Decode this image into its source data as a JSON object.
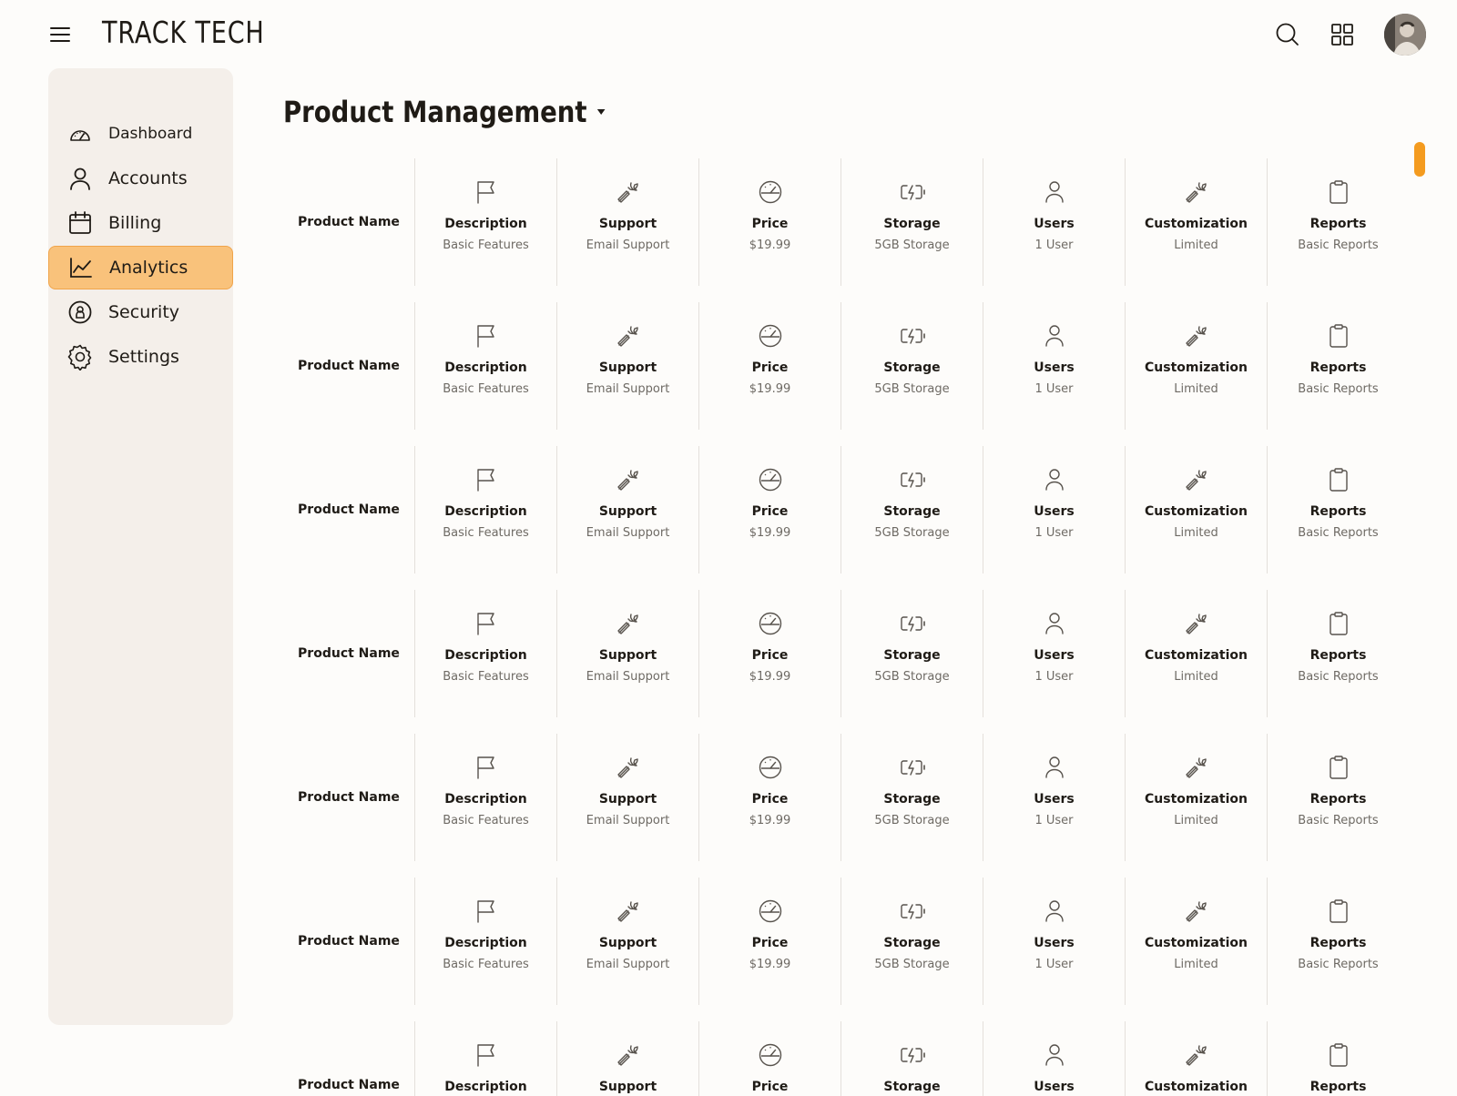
{
  "header": {
    "brand": "TRACK TECH"
  },
  "sidebar": {
    "items": [
      {
        "label": "Dashboard",
        "icon": "gauge-icon"
      },
      {
        "label": "Accounts",
        "icon": "user-icon"
      },
      {
        "label": "Billing",
        "icon": "calendar-icon"
      },
      {
        "label": "Analytics",
        "icon": "chart-line-icon",
        "active": true
      },
      {
        "label": "Security",
        "icon": "shield-lock-icon"
      },
      {
        "label": "Settings",
        "icon": "gear-icon"
      }
    ]
  },
  "main": {
    "title": "Product Management",
    "row_label": "Product Name",
    "columns": [
      {
        "title": "Description",
        "value": "Basic Features",
        "icon": "flag-icon"
      },
      {
        "title": "Support",
        "value": "Email Support",
        "icon": "wrench-icon"
      },
      {
        "title": "Price",
        "value": "$19.99",
        "icon": "gauge-icon"
      },
      {
        "title": "Storage",
        "value": "5GB Storage",
        "icon": "battery-bolt-icon"
      },
      {
        "title": "Users",
        "value": "1 User",
        "icon": "user-icon"
      },
      {
        "title": "Customization",
        "value": "Limited",
        "icon": "wrench-icon"
      },
      {
        "title": "Reports",
        "value": "Basic Reports",
        "icon": "clipboard-icon"
      }
    ]
  },
  "colors": {
    "accent": "#f49b1f",
    "active_bg": "#f9c27b",
    "sidebar_bg": "#f4efea"
  }
}
